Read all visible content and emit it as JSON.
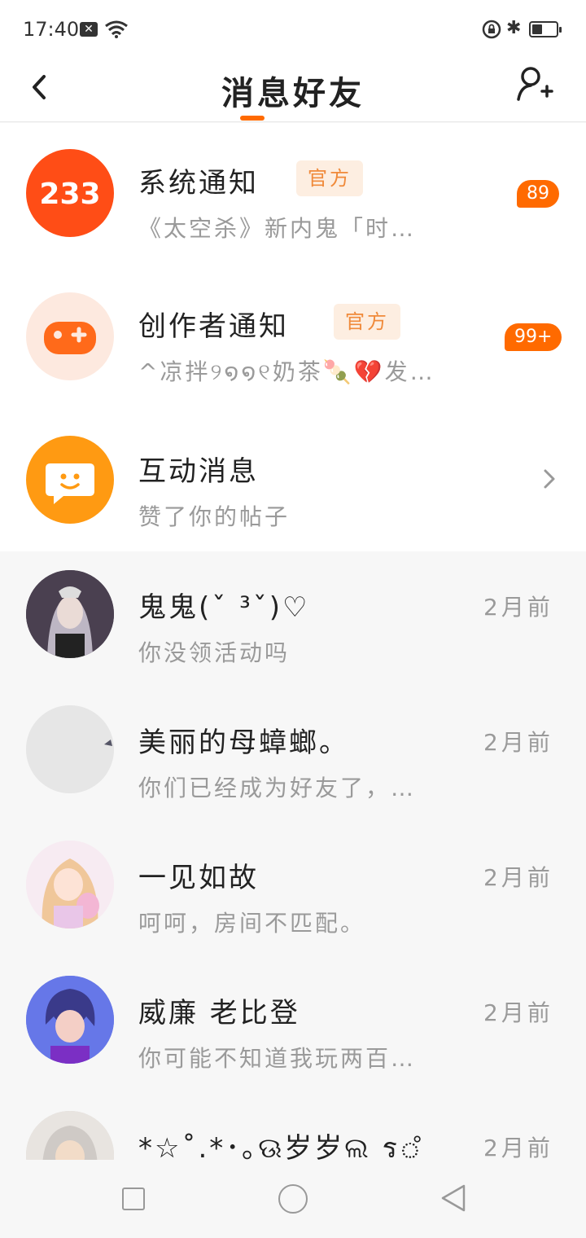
{
  "status_bar": {
    "time": "17:40"
  },
  "header": {
    "title": "消息好友"
  },
  "notices": [
    {
      "avatar_text": "233",
      "title": "系统通知",
      "tag": "官方",
      "preview": "《太空杀》新内鬼「时…",
      "badge": "89"
    },
    {
      "title": "创作者通知",
      "tag": "官方",
      "preview": "^凉拌୨໑໑୧奶茶🍡💔发…",
      "badge": "99+"
    },
    {
      "title": "互动消息",
      "preview": "赞了你的帖子"
    }
  ],
  "friends": [
    {
      "name": "鬼鬼(ˇ ³ˇ)♡",
      "preview": "你没领活动吗",
      "time": "2月前"
    },
    {
      "name": "美丽的母蟑螂。",
      "preview": "你们已经成为好友了，…",
      "time": "2月前"
    },
    {
      "name": "一见如故",
      "preview": "呵呵，房间不匹配。",
      "time": "2月前"
    },
    {
      "name": "威廉 老比登",
      "preview": "你可能不知道我玩两百…",
      "time": "2月前"
    },
    {
      "name": "*☆˚.*･｡ଊ岁岁ଲ ร‌ஂ",
      "preview": "",
      "time": "2月前"
    }
  ],
  "colors": {
    "accent": "#ff6a00",
    "tag_bg": "#fdeee1",
    "tag_text": "#f08a3a"
  }
}
